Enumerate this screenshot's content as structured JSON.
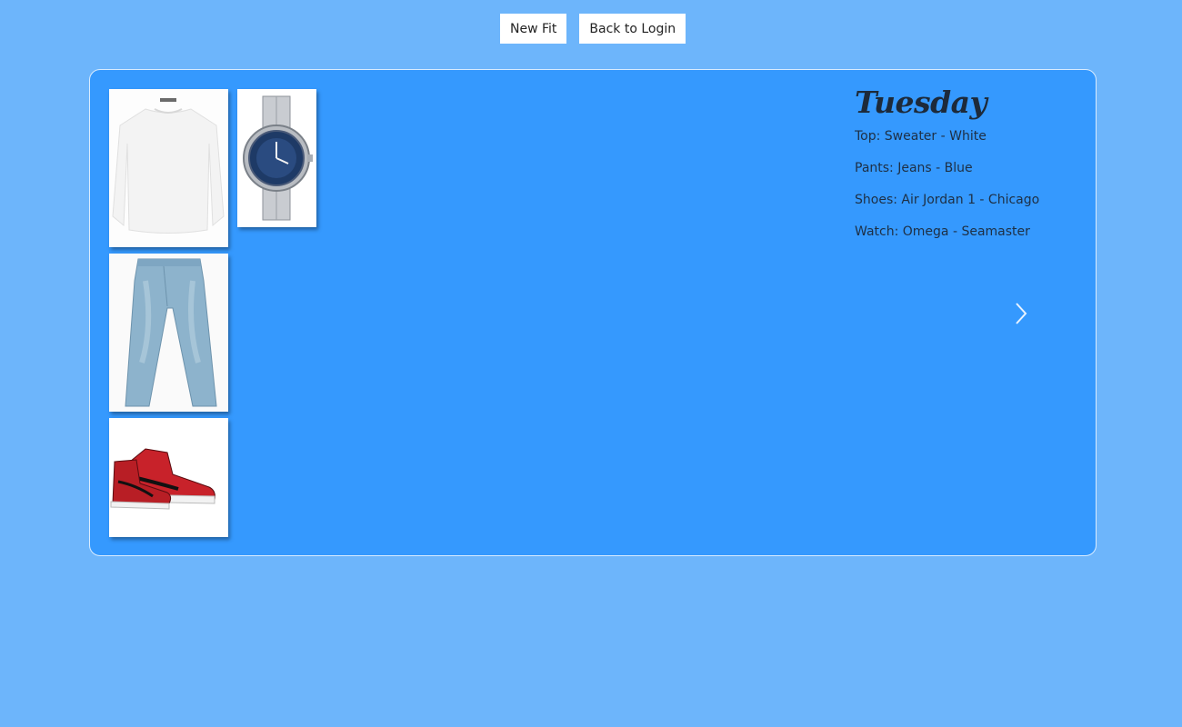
{
  "toolbar": {
    "new_fit_label": "New Fit",
    "back_label": "Back to Login"
  },
  "outfit": {
    "day": "Tuesday",
    "items": [
      {
        "label": "Top: Sweater - White",
        "icon": "sweater-image"
      },
      {
        "label": "Pants: Jeans - Blue",
        "icon": "jeans-image"
      },
      {
        "label": "Shoes: Air Jordan 1 - Chicago",
        "icon": "sneakers-image"
      },
      {
        "label": "Watch: Omega - Seamaster",
        "icon": "watch-image"
      }
    ]
  },
  "colors": {
    "page_background": "#6db5fb",
    "card_background": "#3599fe",
    "text": "#1e2f44"
  },
  "icons": {
    "next": "chevron-right-icon"
  }
}
